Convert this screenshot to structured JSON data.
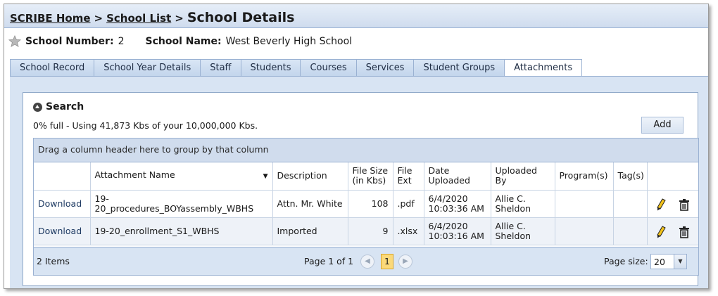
{
  "breadcrumb": {
    "home": "SCRIBE Home",
    "separator": ">",
    "list": "School List",
    "current": "School Details"
  },
  "school": {
    "number_label": "School Number:",
    "number_value": "2",
    "name_label": "School Name:",
    "name_value": "West Beverly High School"
  },
  "tabs": [
    {
      "label": "School Record"
    },
    {
      "label": "School Year Details"
    },
    {
      "label": "Staff"
    },
    {
      "label": "Students"
    },
    {
      "label": "Courses"
    },
    {
      "label": "Services"
    },
    {
      "label": "Student Groups"
    },
    {
      "label": "Attachments"
    }
  ],
  "active_tab": "Attachments",
  "search": {
    "label": "Search"
  },
  "usage_text": "0% full - Using 41,873 Kbs of your 10,000,000 Kbs.",
  "add_label": "Add",
  "grid": {
    "group_hint": "Drag a column header here to group by that column",
    "columns": [
      {
        "label": ""
      },
      {
        "label": "Attachment Name"
      },
      {
        "label": "Description"
      },
      {
        "label": "File Size (in Kbs)"
      },
      {
        "label": "File Ext"
      },
      {
        "label": "Date Uploaded"
      },
      {
        "label": "Uploaded By"
      },
      {
        "label": "Program(s)"
      },
      {
        "label": "Tag(s)"
      },
      {
        "label": ""
      }
    ],
    "rows": [
      {
        "action": "Download",
        "name": "19-20_procedures_BOYassembly_WBHS",
        "description": "Attn. Mr. White",
        "size": "108",
        "ext": ".pdf",
        "date": "6/4/2020 10:03:36 AM",
        "uploaded_by": "Allie C. Sheldon",
        "programs": "",
        "tags": ""
      },
      {
        "action": "Download",
        "name": "19-20_enrollment_S1_WBHS",
        "description": "Imported",
        "size": "9",
        "ext": ".xlsx",
        "date": "6/4/2020 10:03:16 AM",
        "uploaded_by": "Allie C. Sheldon",
        "programs": "",
        "tags": ""
      }
    ]
  },
  "pager": {
    "items_text": "2 Items",
    "page_text": "Page 1 of 1",
    "current_page": "1",
    "page_size_label": "Page size:",
    "page_size": "20"
  },
  "colors": {
    "header_blue": "#cfdcee",
    "panel_blue": "#d8e4f3",
    "page_highlight": "#fbd97a",
    "pencil": "#f2c21a"
  }
}
